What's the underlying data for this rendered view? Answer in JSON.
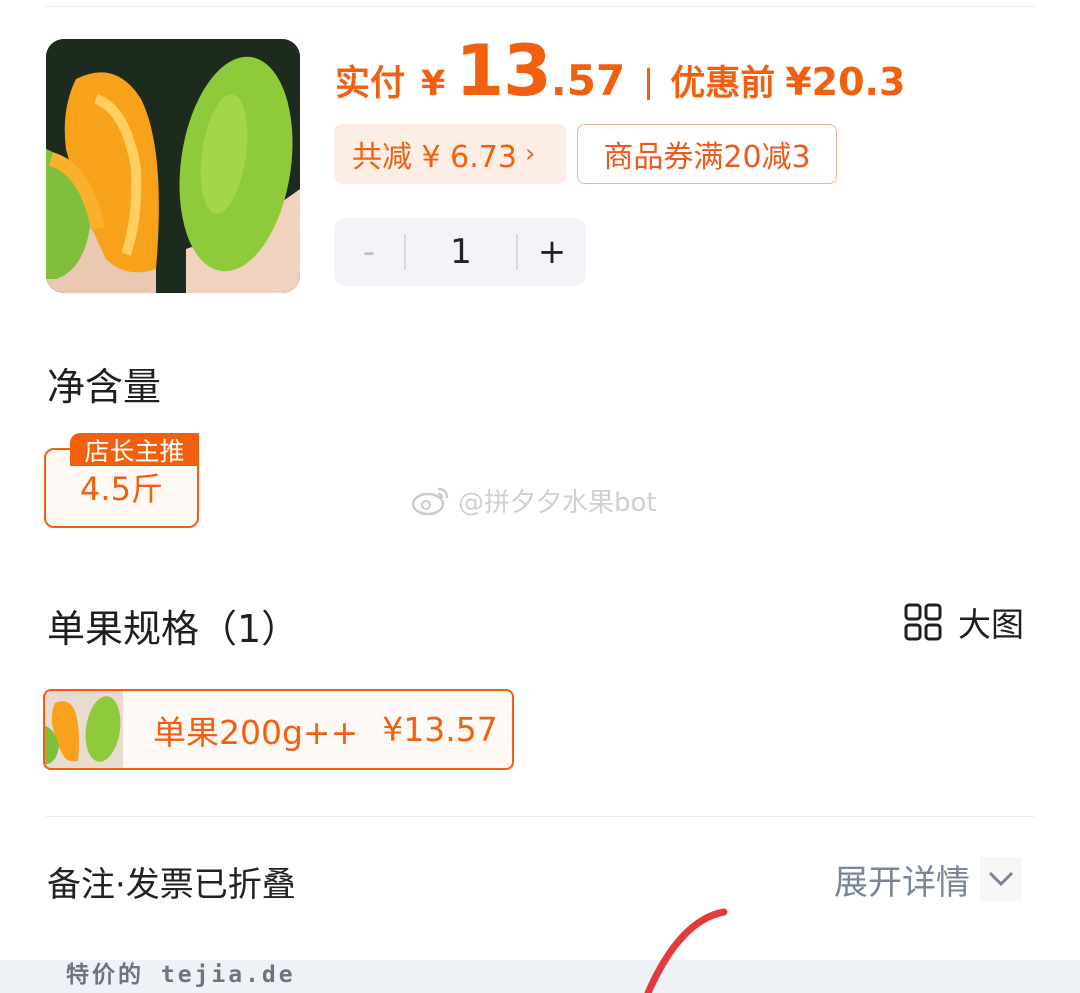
{
  "header": {
    "price_label": "实付",
    "currency": "¥",
    "price_integer": "13",
    "price_decimal": ".57",
    "original_label": "优惠前",
    "original_price": "¥20.3",
    "discount_text": "共减 ¥ 6.73",
    "discount_chevron": "›",
    "coupon_text": "商品券满20减3"
  },
  "stepper": {
    "minus": "-",
    "quantity": "1",
    "plus": "+"
  },
  "net_content": {
    "title": "净含量",
    "badge": "店长主推",
    "option": "4.5斤"
  },
  "watermark": "@拼夕夕水果bot",
  "spec": {
    "title": "单果规格（1）",
    "big_view_label": "大图",
    "option_label": "单果200g++",
    "option_price": "¥13.57"
  },
  "notes": {
    "label": "备注·发票已折叠",
    "expand_label": "展开详情"
  },
  "footer": {
    "site_mark": "特价的 tejia.de"
  },
  "colors": {
    "accent": "#f2600f",
    "chip_bg": "#fdeee5",
    "muted": "#7a8596"
  },
  "icons": [
    "weibo-icon",
    "grid-icon",
    "chevron-down-icon",
    "chevron-right-icon"
  ]
}
